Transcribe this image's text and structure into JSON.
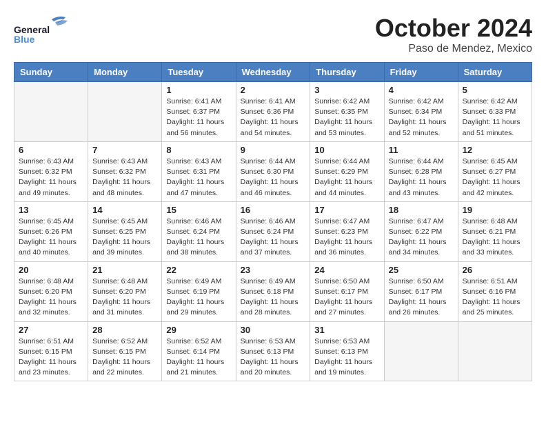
{
  "header": {
    "logo_general": "General",
    "logo_blue": "Blue",
    "month": "October 2024",
    "location": "Paso de Mendez, Mexico"
  },
  "days_of_week": [
    "Sunday",
    "Monday",
    "Tuesday",
    "Wednesday",
    "Thursday",
    "Friday",
    "Saturday"
  ],
  "weeks": [
    [
      {
        "day": "",
        "info": ""
      },
      {
        "day": "",
        "info": ""
      },
      {
        "day": "1",
        "info": "Sunrise: 6:41 AM\nSunset: 6:37 PM\nDaylight: 11 hours and 56 minutes."
      },
      {
        "day": "2",
        "info": "Sunrise: 6:41 AM\nSunset: 6:36 PM\nDaylight: 11 hours and 54 minutes."
      },
      {
        "day": "3",
        "info": "Sunrise: 6:42 AM\nSunset: 6:35 PM\nDaylight: 11 hours and 53 minutes."
      },
      {
        "day": "4",
        "info": "Sunrise: 6:42 AM\nSunset: 6:34 PM\nDaylight: 11 hours and 52 minutes."
      },
      {
        "day": "5",
        "info": "Sunrise: 6:42 AM\nSunset: 6:33 PM\nDaylight: 11 hours and 51 minutes."
      }
    ],
    [
      {
        "day": "6",
        "info": "Sunrise: 6:43 AM\nSunset: 6:32 PM\nDaylight: 11 hours and 49 minutes."
      },
      {
        "day": "7",
        "info": "Sunrise: 6:43 AM\nSunset: 6:32 PM\nDaylight: 11 hours and 48 minutes."
      },
      {
        "day": "8",
        "info": "Sunrise: 6:43 AM\nSunset: 6:31 PM\nDaylight: 11 hours and 47 minutes."
      },
      {
        "day": "9",
        "info": "Sunrise: 6:44 AM\nSunset: 6:30 PM\nDaylight: 11 hours and 46 minutes."
      },
      {
        "day": "10",
        "info": "Sunrise: 6:44 AM\nSunset: 6:29 PM\nDaylight: 11 hours and 44 minutes."
      },
      {
        "day": "11",
        "info": "Sunrise: 6:44 AM\nSunset: 6:28 PM\nDaylight: 11 hours and 43 minutes."
      },
      {
        "day": "12",
        "info": "Sunrise: 6:45 AM\nSunset: 6:27 PM\nDaylight: 11 hours and 42 minutes."
      }
    ],
    [
      {
        "day": "13",
        "info": "Sunrise: 6:45 AM\nSunset: 6:26 PM\nDaylight: 11 hours and 40 minutes."
      },
      {
        "day": "14",
        "info": "Sunrise: 6:45 AM\nSunset: 6:25 PM\nDaylight: 11 hours and 39 minutes."
      },
      {
        "day": "15",
        "info": "Sunrise: 6:46 AM\nSunset: 6:24 PM\nDaylight: 11 hours and 38 minutes."
      },
      {
        "day": "16",
        "info": "Sunrise: 6:46 AM\nSunset: 6:24 PM\nDaylight: 11 hours and 37 minutes."
      },
      {
        "day": "17",
        "info": "Sunrise: 6:47 AM\nSunset: 6:23 PM\nDaylight: 11 hours and 36 minutes."
      },
      {
        "day": "18",
        "info": "Sunrise: 6:47 AM\nSunset: 6:22 PM\nDaylight: 11 hours and 34 minutes."
      },
      {
        "day": "19",
        "info": "Sunrise: 6:48 AM\nSunset: 6:21 PM\nDaylight: 11 hours and 33 minutes."
      }
    ],
    [
      {
        "day": "20",
        "info": "Sunrise: 6:48 AM\nSunset: 6:20 PM\nDaylight: 11 hours and 32 minutes."
      },
      {
        "day": "21",
        "info": "Sunrise: 6:48 AM\nSunset: 6:20 PM\nDaylight: 11 hours and 31 minutes."
      },
      {
        "day": "22",
        "info": "Sunrise: 6:49 AM\nSunset: 6:19 PM\nDaylight: 11 hours and 29 minutes."
      },
      {
        "day": "23",
        "info": "Sunrise: 6:49 AM\nSunset: 6:18 PM\nDaylight: 11 hours and 28 minutes."
      },
      {
        "day": "24",
        "info": "Sunrise: 6:50 AM\nSunset: 6:17 PM\nDaylight: 11 hours and 27 minutes."
      },
      {
        "day": "25",
        "info": "Sunrise: 6:50 AM\nSunset: 6:17 PM\nDaylight: 11 hours and 26 minutes."
      },
      {
        "day": "26",
        "info": "Sunrise: 6:51 AM\nSunset: 6:16 PM\nDaylight: 11 hours and 25 minutes."
      }
    ],
    [
      {
        "day": "27",
        "info": "Sunrise: 6:51 AM\nSunset: 6:15 PM\nDaylight: 11 hours and 23 minutes."
      },
      {
        "day": "28",
        "info": "Sunrise: 6:52 AM\nSunset: 6:15 PM\nDaylight: 11 hours and 22 minutes."
      },
      {
        "day": "29",
        "info": "Sunrise: 6:52 AM\nSunset: 6:14 PM\nDaylight: 11 hours and 21 minutes."
      },
      {
        "day": "30",
        "info": "Sunrise: 6:53 AM\nSunset: 6:13 PM\nDaylight: 11 hours and 20 minutes."
      },
      {
        "day": "31",
        "info": "Sunrise: 6:53 AM\nSunset: 6:13 PM\nDaylight: 11 hours and 19 minutes."
      },
      {
        "day": "",
        "info": ""
      },
      {
        "day": "",
        "info": ""
      }
    ]
  ]
}
